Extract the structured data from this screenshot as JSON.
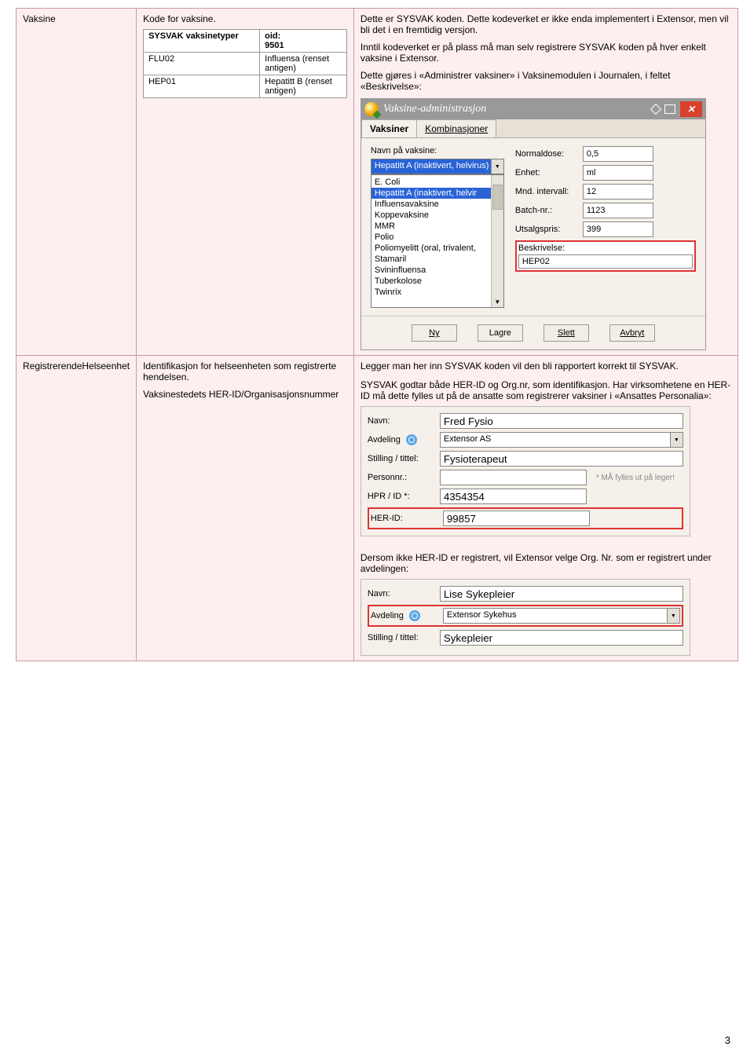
{
  "row1": {
    "label": "Vaksine",
    "col2_label": "Kode for vaksine.",
    "inner": {
      "h1": "SYSVAK vaksinetyper",
      "h2a": "oid:",
      "h2b": "9501",
      "r1a": "FLU02",
      "r1b": "Influensa (renset antigen)",
      "r2a": "HEP01",
      "r2b": "Hepatitt B (renset antigen)"
    },
    "p1": "Dette er SYSVAK koden. Dette kodeverket er ikke enda implementert i Extensor, men vil bli det i en fremtidig versjon.",
    "p2": "Inntil kodeverket er på plass må man selv registrere SYSVAK koden på hver enkelt vaksine i Extensor.",
    "p3": "Dette gjøres i «Administrer vaksiner» i Vaksinemodulen i Journalen, i feltet «Beskrivelse»:"
  },
  "dialog": {
    "title": "Vaksine-administrasjon",
    "tabs": {
      "a": "Vaksiner",
      "b": "Kombinasjoner"
    },
    "navn_label": "Navn på vaksine:",
    "selected": "Hepatitt A (inaktivert, helvirus)",
    "list": [
      "E. Coli",
      "Hepatitt A (inaktivert, helvir",
      "Influensavaksine",
      "Koppevaksine",
      "MMR",
      "Polio",
      "Poliomyelitt (oral, trivalent,",
      "Stamaril",
      "Svininfluensa",
      "Tuberkolose",
      "Twinrix"
    ],
    "fields": {
      "normaldose": {
        "label": "Normaldose:",
        "value": "0,5"
      },
      "enhet": {
        "label": "Enhet:",
        "value": "ml"
      },
      "intervall": {
        "label": "Mnd. intervall:",
        "value": "12"
      },
      "batch": {
        "label": "Batch-nr.:",
        "value": "1123"
      },
      "pris": {
        "label": "Utsalgspris:",
        "value": "399"
      },
      "beskr_label": "Beskrivelse:",
      "beskr_value": "HEP02"
    },
    "buttons": {
      "ny": "Ny",
      "lagre": "Lagre",
      "slett": "Slett",
      "avbryt": "Avbryt"
    }
  },
  "row2": {
    "label": "RegistrerendeHelseenhet",
    "col2a": "Identifikasjon for helseenheten som registrerte hendelsen.",
    "col2b": "Vaksinestedets HER-ID/Organisasjonsnummer",
    "p0": "Legger man her inn SYSVAK koden vil den bli rapportert korrekt til SYSVAK.",
    "p1": "SYSVAK godtar både HER-ID og Org.nr, som identifikasjon. Har virksomhetene en HER-ID må dette fylles ut på de ansatte som registrerer vaksiner i «Ansattes Personalia»:",
    "form1": {
      "navn": {
        "label": "Navn:",
        "value": "Fred Fysio"
      },
      "avdeling": {
        "label": "Avdeling",
        "value": "Extensor AS"
      },
      "stilling": {
        "label": "Stilling / tittel:",
        "value": "Fysioterapeut"
      },
      "personnr": {
        "label": "Personnr.:",
        "value": "",
        "note": "* MÅ fylles ut på leger!"
      },
      "hpr": {
        "label": "HPR / ID *:",
        "value": "4354354"
      },
      "herid": {
        "label": "HER-ID:",
        "value": "99857"
      }
    },
    "p2": "Dersom ikke HER-ID er registrert, vil Extensor velge Org. Nr. som er registrert under avdelingen:",
    "form2": {
      "navn": {
        "label": "Navn:",
        "value": "Lise Sykepleier"
      },
      "avdeling": {
        "label": "Avdeling",
        "value": "Extensor Sykehus"
      },
      "stilling": {
        "label": "Stilling / tittel:",
        "value": "Sykepleier"
      }
    }
  },
  "page_num": "3"
}
